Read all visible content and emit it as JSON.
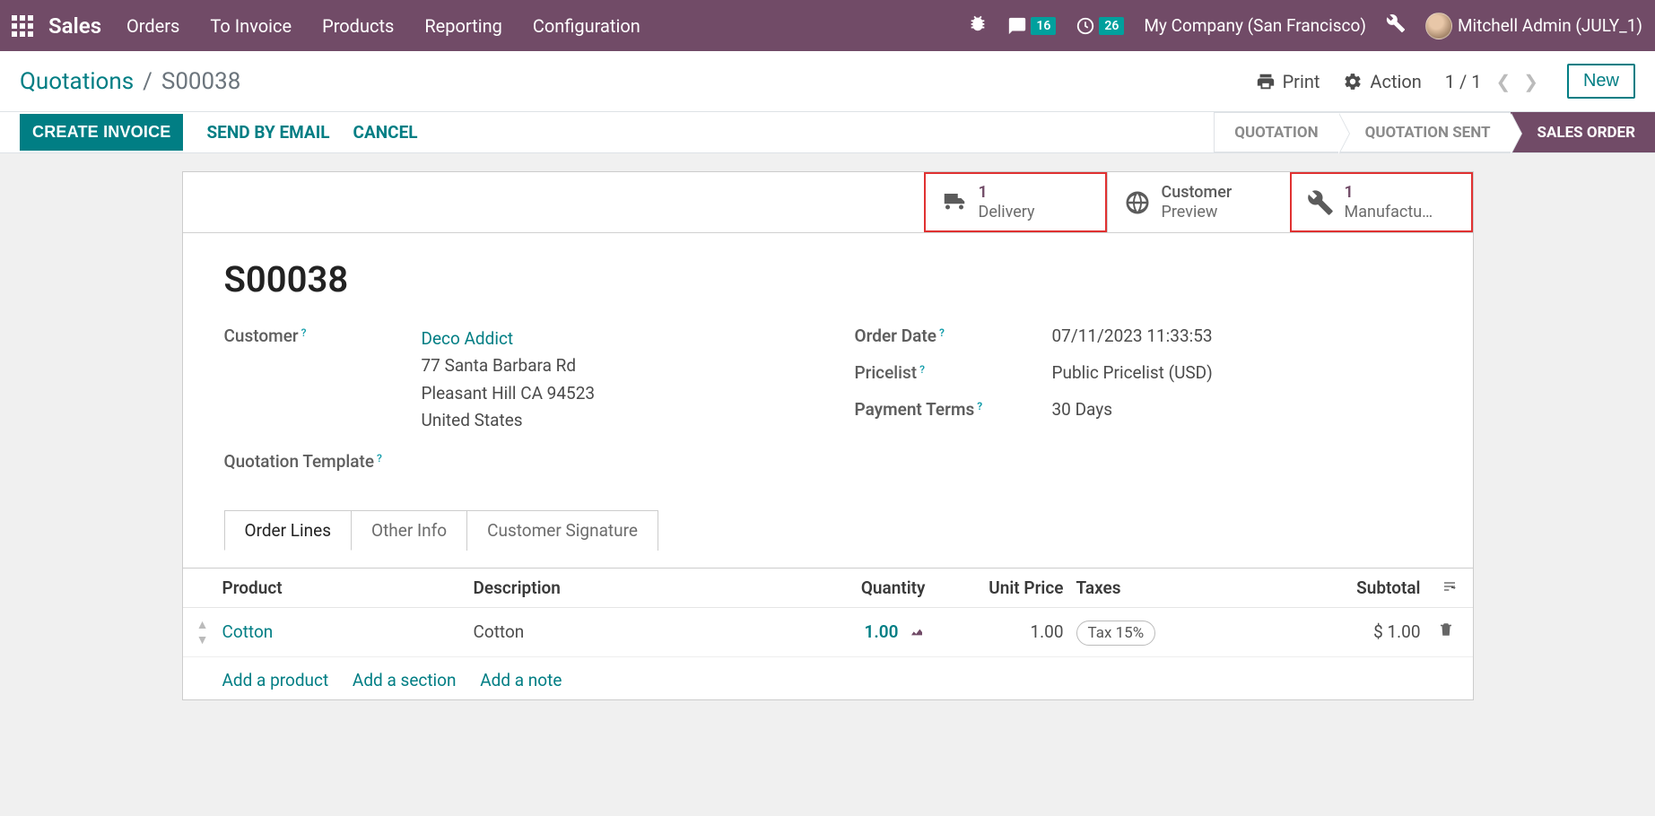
{
  "topnav": {
    "brand": "Sales",
    "menu": [
      "Orders",
      "To Invoice",
      "Products",
      "Reporting",
      "Configuration"
    ],
    "messages_badge": "16",
    "activities_badge": "26",
    "company": "My Company (San Francisco)",
    "user": "Mitchell Admin (JULY_1)"
  },
  "breadcrumb": {
    "parent": "Quotations",
    "current": "S00038"
  },
  "controls": {
    "print": "Print",
    "action": "Action",
    "pager": "1 / 1",
    "new": "New"
  },
  "statusbar": {
    "create_invoice": "CREATE INVOICE",
    "send_email": "SEND BY EMAIL",
    "cancel": "CANCEL",
    "stages": {
      "quotation": "QUOTATION",
      "quotation_sent": "QUOTATION SENT",
      "sales_order": "SALES ORDER"
    }
  },
  "statbtns": {
    "delivery": {
      "num": "1",
      "label": "Delivery"
    },
    "preview": {
      "num": "Customer",
      "label": "Preview"
    },
    "manufacturing": {
      "num": "1",
      "label": "Manufactu…"
    }
  },
  "record": {
    "name": "S00038",
    "labels": {
      "customer": "Customer",
      "quotation_template": "Quotation Template",
      "order_date": "Order Date",
      "pricelist": "Pricelist",
      "payment_terms": "Payment Terms"
    },
    "customer": {
      "name": "Deco Addict",
      "street": "77 Santa Barbara Rd",
      "city": "Pleasant Hill CA 94523",
      "country": "United States"
    },
    "order_date": "07/11/2023 11:33:53",
    "pricelist": "Public Pricelist (USD)",
    "payment_terms": "30 Days"
  },
  "tabs": {
    "order_lines": "Order Lines",
    "other_info": "Other Info",
    "customer_signature": "Customer Signature"
  },
  "table": {
    "headers": {
      "product": "Product",
      "description": "Description",
      "quantity": "Quantity",
      "unit_price": "Unit Price",
      "taxes": "Taxes",
      "subtotal": "Subtotal"
    },
    "rows": [
      {
        "product": "Cotton",
        "description": "Cotton",
        "quantity": "1.00",
        "unit_price": "1.00",
        "tax": "Tax 15%",
        "subtotal": "$ 1.00"
      }
    ],
    "add_product": "Add a product",
    "add_section": "Add a section",
    "add_note": "Add a note"
  }
}
